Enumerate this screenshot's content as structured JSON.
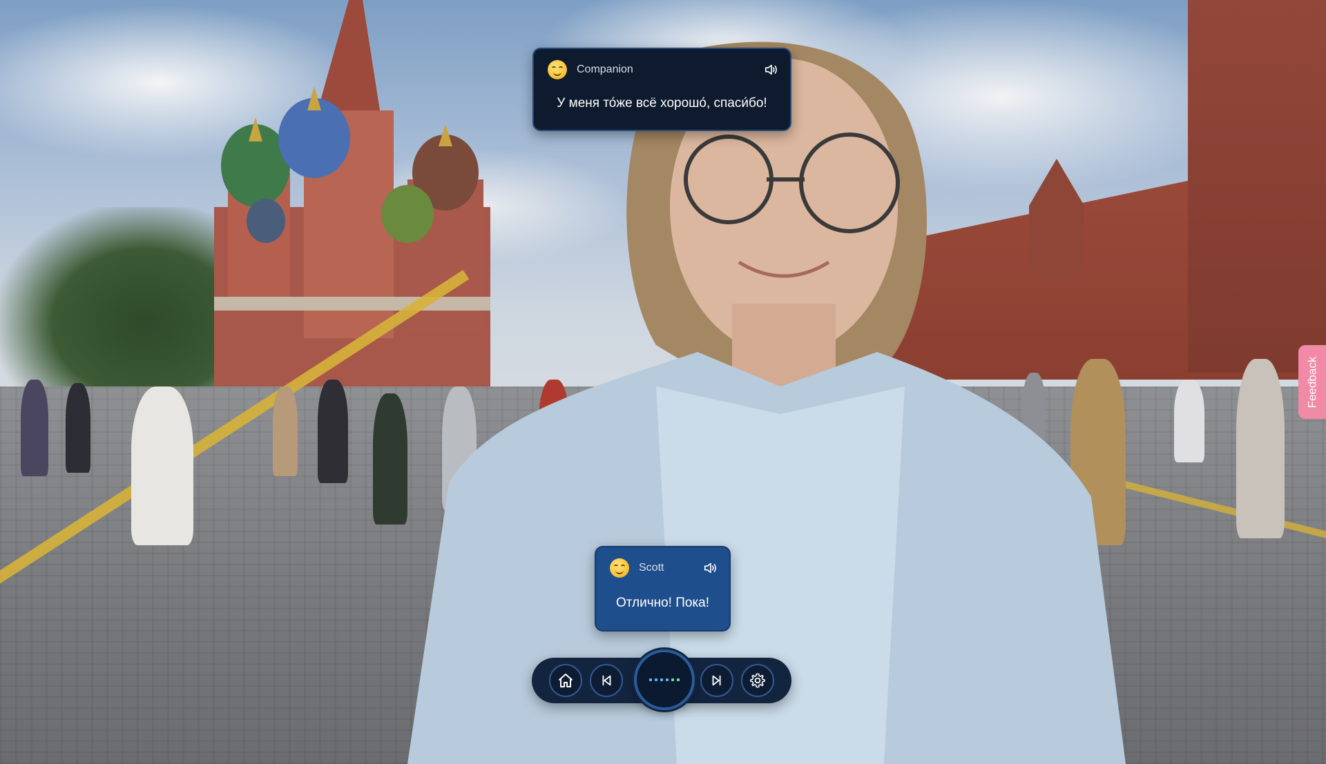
{
  "companion_message": {
    "speaker": "Companion",
    "text": "У меня то́же всё хорошо́, спаси́бо!",
    "emoji_icon": "smiling-face-icon",
    "audio_icon": "speaker-volume-icon"
  },
  "user_message": {
    "speaker": "Scott",
    "text": "Отлично! Пока!",
    "emoji_icon": "smiling-face-icon",
    "audio_icon": "speaker-volume-icon"
  },
  "controls": {
    "home_icon": "home-icon",
    "previous_icon": "skip-previous-icon",
    "mic_icon": "voice-listening-dots-icon",
    "next_icon": "skip-next-icon",
    "settings_icon": "gear-icon"
  },
  "feedback": {
    "label": "Feedback"
  },
  "colors": {
    "companion_bubble": "#0e1b2e",
    "user_bubble": "#1f4e8c",
    "control_bar": "#13243f",
    "feedback_tab": "#f08aa6",
    "listening_dots": "#5fb3ff"
  }
}
